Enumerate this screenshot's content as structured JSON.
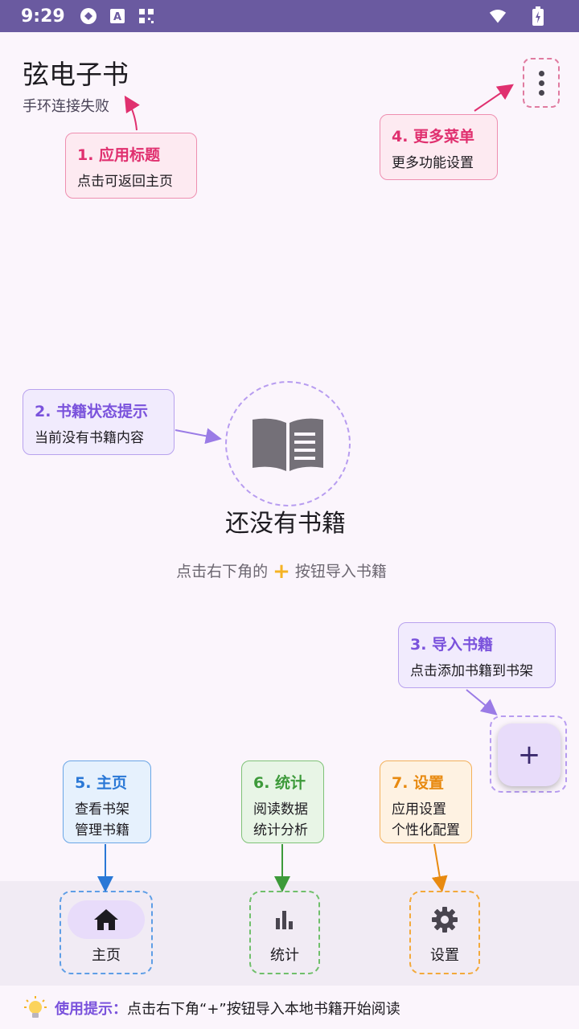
{
  "status_bar": {
    "time": "9:29",
    "icons": [
      "sync-icon",
      "font-icon",
      "qr-icon",
      "wifi-icon",
      "battery-charging-icon"
    ]
  },
  "header": {
    "title": "弦电子书",
    "subtitle": "手环连接失败"
  },
  "callouts": {
    "app_title": {
      "title": "1. 应用标题",
      "desc": "点击可返回主页"
    },
    "book_status": {
      "title": "2. 书籍状态提示",
      "desc": "当前没有书籍内容"
    },
    "import": {
      "title": "3. 导入书籍",
      "desc": "点击添加书籍到书架"
    },
    "more_menu": {
      "title": "4. 更多菜单",
      "desc": "更多功能设置"
    },
    "home": {
      "title": "5. 主页",
      "line1": "查看书架",
      "line2": "管理书籍"
    },
    "stats": {
      "title": "6. 统计",
      "line1": "阅读数据",
      "line2": "统计分析"
    },
    "settings": {
      "title": "7. 设置",
      "line1": "应用设置",
      "line2": "个性化配置"
    }
  },
  "empty_state": {
    "title": "还没有书籍",
    "hint_before": "点击右下角的",
    "hint_after": "按钮导入书籍",
    "plus": "+"
  },
  "fab": {
    "label": "+"
  },
  "nav": {
    "home": "主页",
    "stats": "统计",
    "settings": "设置"
  },
  "tip": {
    "label": "使用提示：",
    "text": "点击右下角“+”按钮导入本地书籍开始阅读"
  },
  "colors": {
    "status_bar": "#6a5aa0",
    "accent_purple": "#7a52dc",
    "pink": "#e0306f",
    "blue": "#2a78d6",
    "green": "#3d9a3a",
    "orange": "#e88a10"
  }
}
